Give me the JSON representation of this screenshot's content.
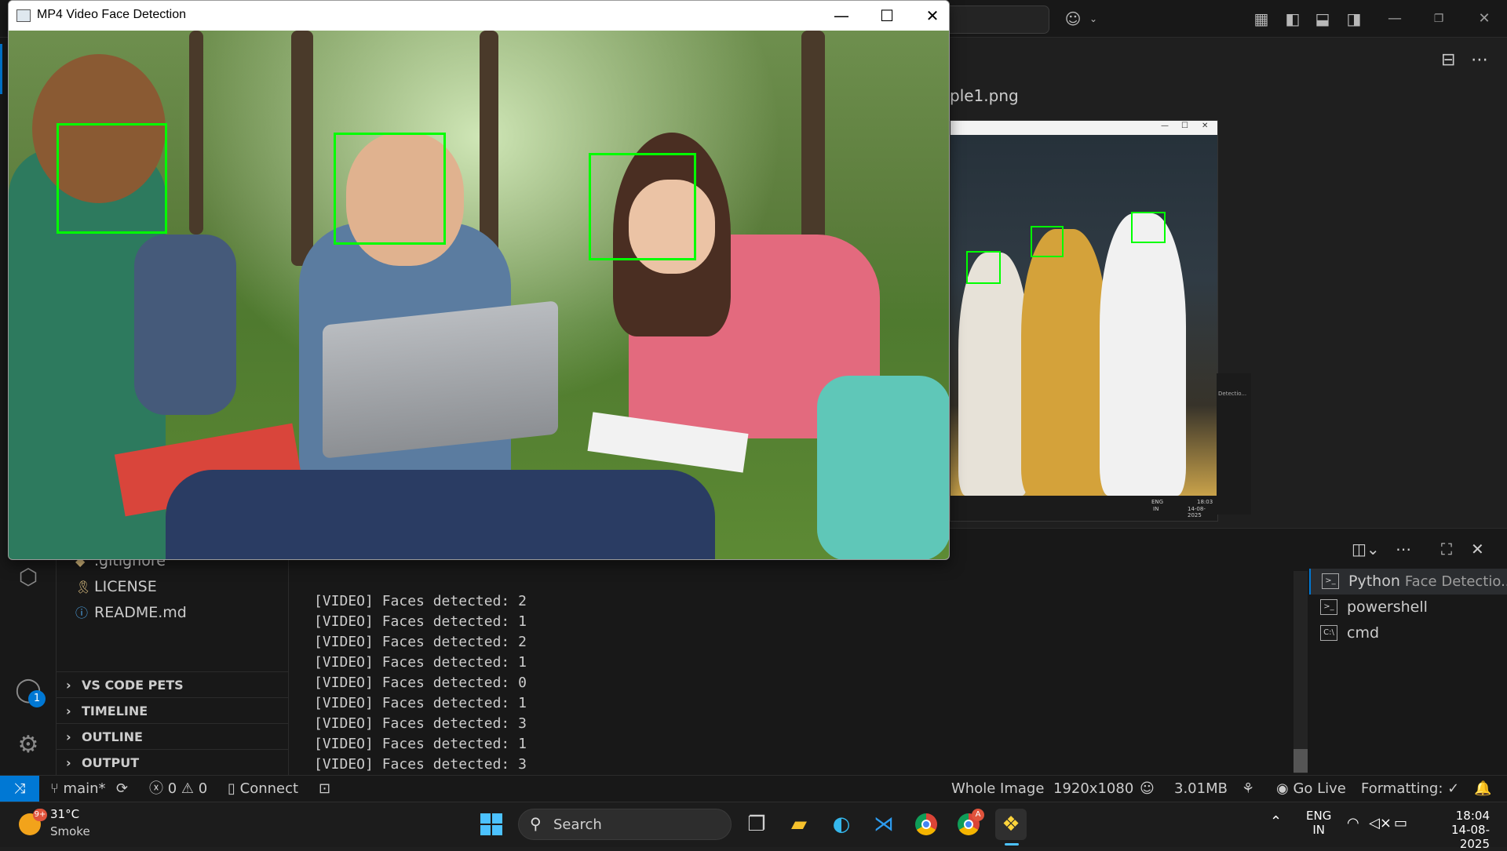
{
  "cv_window": {
    "title": "MP4 Video Face Detection",
    "controls": {
      "minimize": "—",
      "maximize": "☐",
      "close": "✕"
    }
  },
  "editor": {
    "tab_title": "ple1.png",
    "preview": {
      "taskbar_lang": "ENG",
      "taskbar_region": "IN",
      "taskbar_time": "18:03",
      "taskbar_date": "14-08-2025",
      "side_label": "Detectio..."
    }
  },
  "sidebar": {
    "files": [
      {
        "name": ".gitignore",
        "icon": "gitignore-icon"
      },
      {
        "name": "LICENSE",
        "icon": "license-icon"
      },
      {
        "name": "README.md",
        "icon": "info-icon"
      }
    ],
    "sections": [
      "VS CODE PETS",
      "TIMELINE",
      "OUTLINE",
      "OUTPUT"
    ]
  },
  "terminal": {
    "lines": [
      "[VIDEO] Faces detected: 2",
      "[VIDEO] Faces detected: 1",
      "[VIDEO] Faces detected: 2",
      "[VIDEO] Faces detected: 1",
      "[VIDEO] Faces detected: 0",
      "[VIDEO] Faces detected: 1",
      "[VIDEO] Faces detected: 3",
      "[VIDEO] Faces detected: 1",
      "[VIDEO] Faces detected: 3"
    ],
    "sessions": [
      {
        "name": "Python",
        "subtitle": "Face Detectio...",
        "active": true
      },
      {
        "name": "powershell",
        "subtitle": "",
        "active": false
      },
      {
        "name": "cmd",
        "subtitle": "",
        "active": false
      }
    ]
  },
  "activity": {
    "account_badge": "1"
  },
  "status_bar": {
    "branch": "main*",
    "errors": "0",
    "warnings": "0",
    "connect": "Connect",
    "image_mode": "Whole Image",
    "dimensions": "1920x1080",
    "file_size": "3.01MB",
    "go_live": "Go Live",
    "formatting": "Formatting: ✓"
  },
  "taskbar": {
    "weather_temp": "31°C",
    "weather_desc": "Smoke",
    "weather_badge": "9+",
    "search_label": "Search",
    "lang": "ENG",
    "region": "IN",
    "time": "18:04",
    "date": "14-08-2025",
    "chrome_badge": "A"
  },
  "colors": {
    "face_box": "#00ff00",
    "accent": "#0078d4",
    "vscode_bg": "#1f1f1f"
  }
}
